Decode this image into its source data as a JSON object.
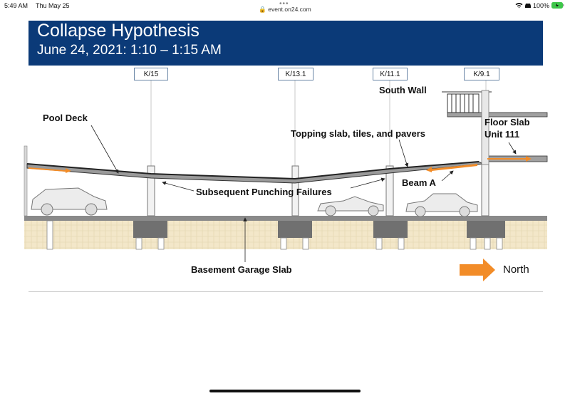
{
  "status": {
    "time": "5:49 AM",
    "date": "Thu May 25",
    "battery": "100%",
    "url": "event.on24.com"
  },
  "banner": {
    "title": "Collapse Hypothesis",
    "subtitle": "June 24, 2021: 1:10 – 1:15 AM"
  },
  "gridlines": [
    "K/15",
    "K/13.1",
    "K/11.1",
    "K/9.1"
  ],
  "labels": {
    "pool_deck": "Pool Deck",
    "south_wall": "South Wall",
    "floor_slab_line1": "Floor Slab",
    "floor_slab_line2": "Unit 111",
    "topping_slab": "Topping slab, tiles, and pavers",
    "punching_failures": "Subsequent Punching Failures",
    "beam_a": "Beam A",
    "garage_slab": "Basement Garage Slab",
    "north": "North"
  },
  "colors": {
    "banner": "#0b3a78",
    "arrow": "#f28c28",
    "soil": "#f3e7c9",
    "footing": "#707070"
  },
  "icons": [
    "wifi-icon",
    "car-icon",
    "battery-icon",
    "north-arrow-icon"
  ]
}
